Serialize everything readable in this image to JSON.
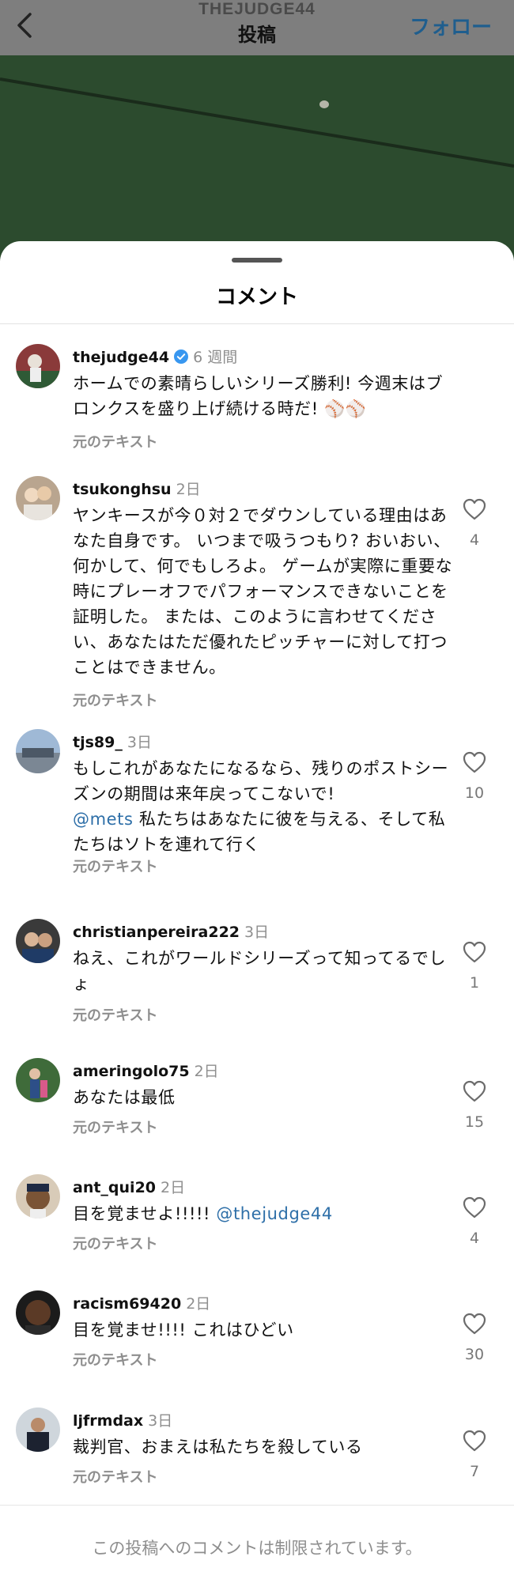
{
  "header": {
    "username": "THEJUDGE44",
    "title": "投稿",
    "follow_label": "フォロー"
  },
  "sheet": {
    "title": "コメント",
    "restricted_note": "この投稿へのコメントは制限されています。"
  },
  "colors": {
    "mention": "#2e6fa8",
    "verified": "#3897f0",
    "muted": "#8e8e8e"
  },
  "comments": [
    {
      "user": "thejudge44",
      "verified": true,
      "time": "6 週間",
      "text": "ホームでの素晴らしいシリーズ勝利! 今週末はブロンクスを盛り上げ続ける時だ! ⚾⚾",
      "translate": "元のテキスト"
    },
    {
      "user": "tsukonghsu",
      "time": "2日",
      "text": "ヤンキースが今０対２でダウンしている理由はあなた自身です。 いつまで吸うつもり? おいおい、何かして、何でもしろよ。 ゲームが実際に重要な時にプレーオフでパフォーマンスできないことを証明した。 または、このように言わせてください、あなたはただ優れたピッチャーに対して打つことはできません。",
      "translate": "元のテキスト",
      "likes": "4"
    },
    {
      "user": "tjs89_",
      "time": "3日",
      "text_pre": "もしこれがあなたになるなら、残りのポストシーズンの期間は来年戻ってこないで!",
      "mention": "@mets",
      "text_post": " 私たちはあなたに彼を与える、そして私たちはソトを連れて行く",
      "translate": "元のテキスト",
      "likes": "10"
    },
    {
      "user": "christianpereira222",
      "time": "3日",
      "text": "ねえ、これがワールドシリーズって知ってるでしょ",
      "translate": "元のテキスト",
      "likes": "1"
    },
    {
      "user": "ameringolo75",
      "time": "2日",
      "text": "あなたは最低",
      "translate": "元のテキスト",
      "likes": "15"
    },
    {
      "user": "ant_qui20",
      "time": "2日",
      "text_pre": "目を覚ませよ!!!!! ",
      "mention": "@thejudge44",
      "translate": "元のテキスト",
      "likes": "4"
    },
    {
      "user": "racism69420",
      "time": "2日",
      "text": "目を覚ませ!!!! これはひどい",
      "translate": "元のテキスト",
      "likes": "30"
    },
    {
      "user": "ljfrmdax",
      "time": "3日",
      "text": "裁判官、おまえは私たちを殺している",
      "translate": "元のテキスト",
      "likes": "7"
    }
  ]
}
